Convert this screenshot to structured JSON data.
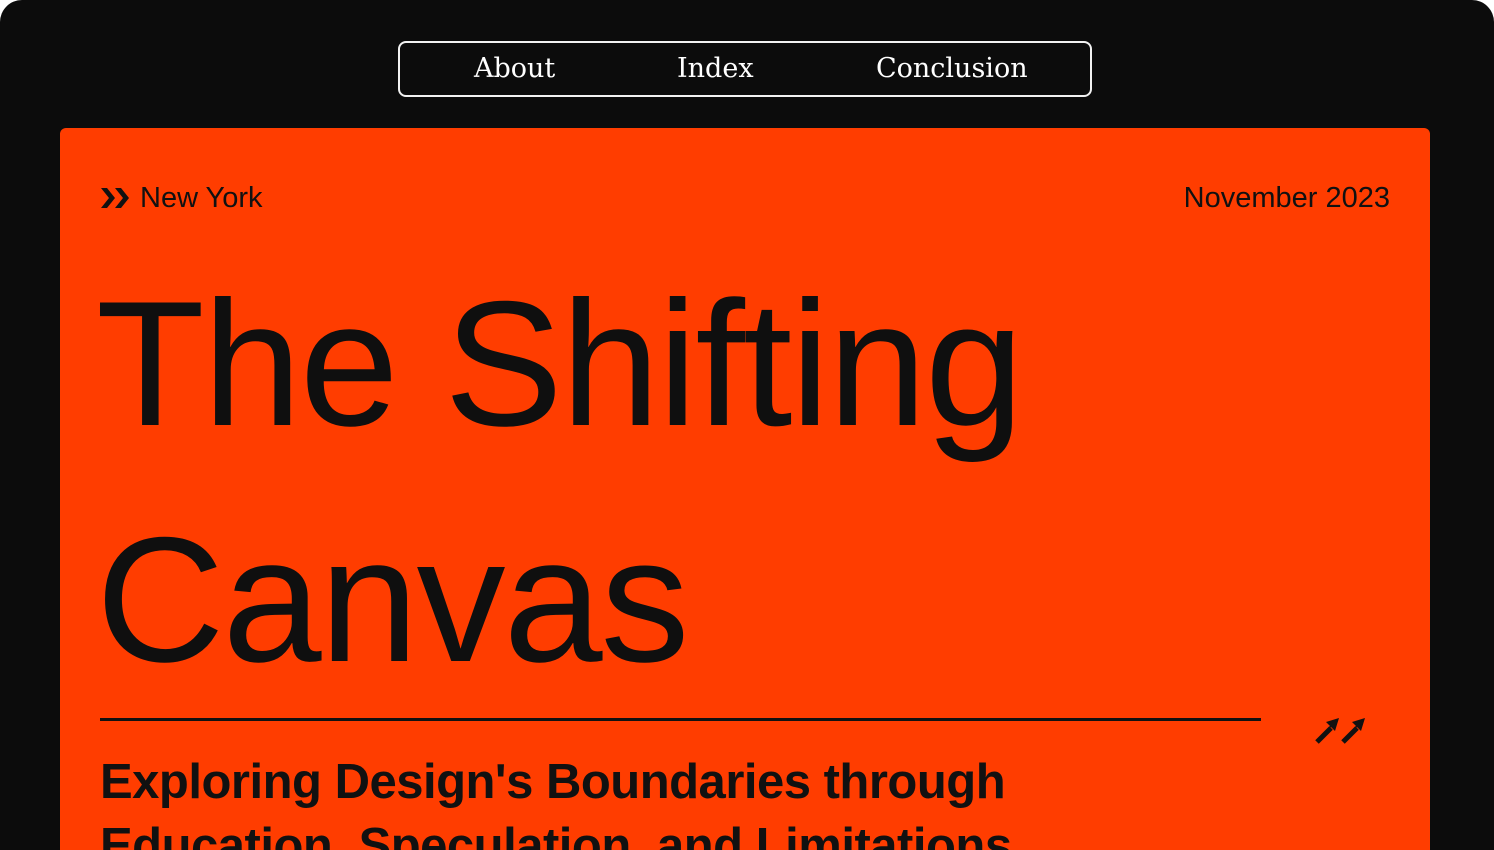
{
  "nav": {
    "items": [
      {
        "label": "About"
      },
      {
        "label": "Index"
      },
      {
        "label": "Conclusion"
      }
    ]
  },
  "hero": {
    "location": "New York",
    "date": "November 2023",
    "title": "The Shifting Canvas",
    "subtitle": "Exploring Design's Boundaries through Education, Speculation, and Limitations"
  },
  "icons": {
    "location": "double-chevron-right-icon",
    "divider_end": "double-arrow-up-right-icon"
  },
  "colors": {
    "background": "#0c0c0c",
    "accent": "#ff3d00",
    "text_dark": "#111111",
    "nav_text": "#ffffff"
  }
}
